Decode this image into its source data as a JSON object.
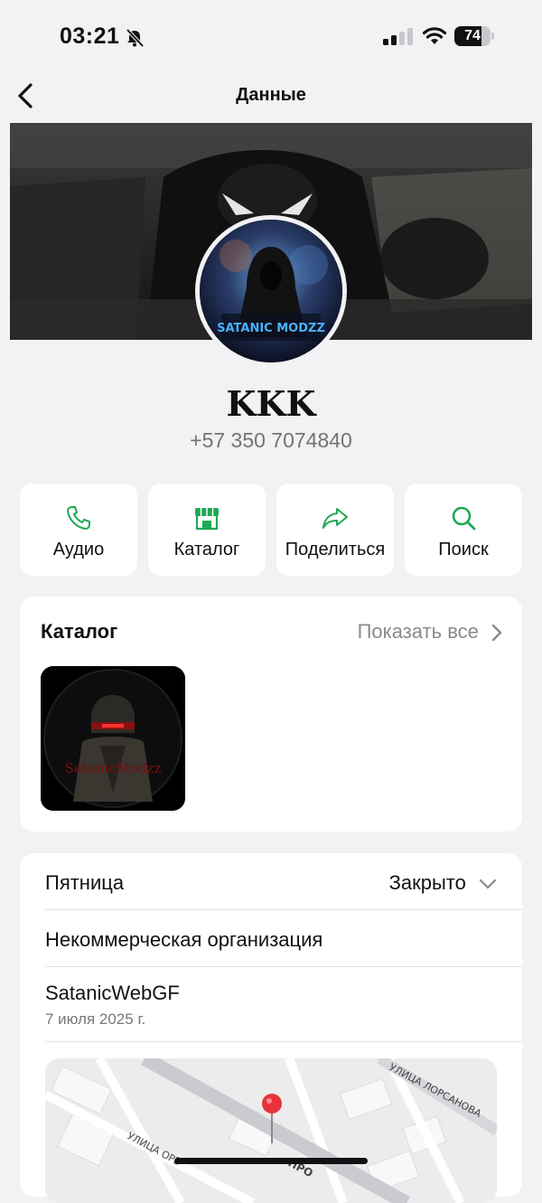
{
  "status_bar": {
    "time": "03:21",
    "battery": "74",
    "battery_level": 0.74
  },
  "nav": {
    "title": "Данные"
  },
  "profile": {
    "name": "KKK",
    "phone": "+57 350 7074840",
    "avatar_text": "SATANIC MODZZ",
    "catalog_thumb_text": "SatanicModzz"
  },
  "actions": [
    {
      "label": "Аудио",
      "icon": "phone-icon"
    },
    {
      "label": "Каталог",
      "icon": "storefront-icon"
    },
    {
      "label": "Поделиться",
      "icon": "share-icon"
    },
    {
      "label": "Поиск",
      "icon": "search-icon"
    }
  ],
  "catalog": {
    "title": "Каталог",
    "show_all": "Показать все"
  },
  "info": {
    "day": "Пятница",
    "status": "Закрыто",
    "category": "Некоммерческая организация",
    "website": "SatanicWebGF",
    "date": "7 июля 2025 г."
  },
  "map": {
    "street_1": "УЛИЦА ЛОРСАНОВА",
    "street_2": "УЛИЦА ОРЗ",
    "street_3": "ПРО"
  },
  "colors": {
    "accent": "#1fa855",
    "background": "#f2f2f4",
    "card": "#ffffff",
    "muted": "#8a8a8e",
    "pin": "#e8333c"
  }
}
